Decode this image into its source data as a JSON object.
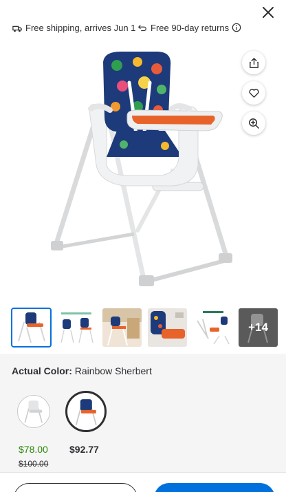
{
  "shipping": {
    "free_shipping": "Free shipping, arrives Jun 1",
    "free_returns": "Free 90-day returns"
  },
  "icons": {
    "close": "close-icon",
    "share": "share-icon",
    "favorite": "heart-icon",
    "zoom": "zoom-in-icon",
    "info": "info-icon"
  },
  "gallery": {
    "more_count": "+14"
  },
  "variant": {
    "label": "Actual Color:",
    "value": "Rainbow Sherbert",
    "options": [
      {
        "price": "$78.00",
        "was_price": "$100.00"
      },
      {
        "price": "$92.77"
      }
    ]
  },
  "colors": {
    "accent": "#0071dc",
    "sale_green": "#2a8703",
    "tray_orange": "#e8632a",
    "seat_navy": "#1d3a7a"
  }
}
